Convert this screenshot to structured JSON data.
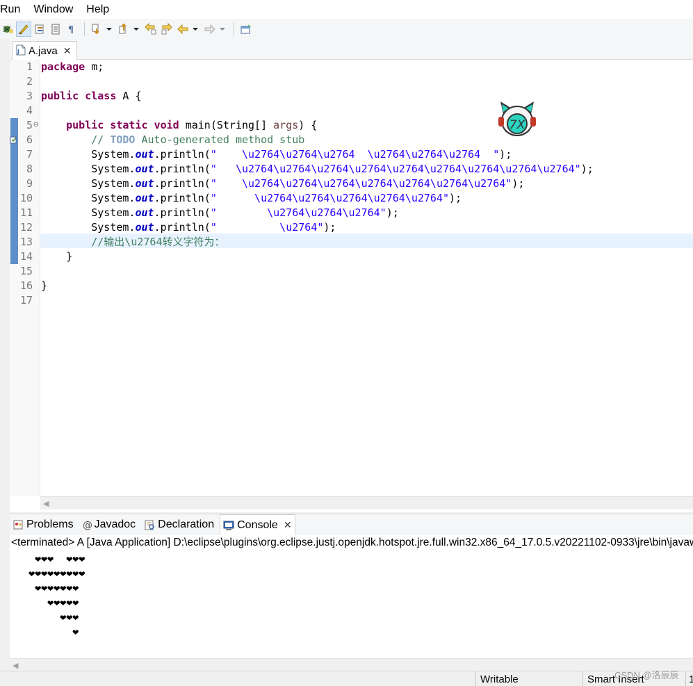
{
  "menubar": {
    "items": [
      "Run",
      "Window",
      "Help"
    ]
  },
  "editor": {
    "tab_label": "A.java",
    "line_numbers": [
      "1",
      "2",
      "3",
      "4",
      "5",
      "6",
      "7",
      "8",
      "9",
      "10",
      "11",
      "12",
      "13",
      "14",
      "15",
      "16",
      "17"
    ],
    "lines": [
      [
        {
          "t": "package",
          "c": "kw"
        },
        {
          "t": " m;"
        }
      ],
      [],
      [
        {
          "t": "public",
          "c": "kw"
        },
        {
          "t": " "
        },
        {
          "t": "class",
          "c": "kw"
        },
        {
          "t": " A {"
        }
      ],
      [],
      [
        {
          "t": "    "
        },
        {
          "t": "public",
          "c": "kw"
        },
        {
          "t": " "
        },
        {
          "t": "static",
          "c": "kw"
        },
        {
          "t": " "
        },
        {
          "t": "void",
          "c": "kw"
        },
        {
          "t": " main(String[] "
        },
        {
          "t": "args",
          "c": "param"
        },
        {
          "t": ") {"
        }
      ],
      [
        {
          "t": "        "
        },
        {
          "t": "// ",
          "c": "cmt"
        },
        {
          "t": "TODO",
          "c": "todo"
        },
        {
          "t": " Auto-generated method stub",
          "c": "cmt"
        }
      ],
      [
        {
          "t": "        System."
        },
        {
          "t": "out",
          "c": "field"
        },
        {
          "t": ".println("
        },
        {
          "t": "\"    \\u2764\\u2764\\u2764  \\u2764\\u2764\\u2764  \"",
          "c": "str"
        },
        {
          "t": ");"
        }
      ],
      [
        {
          "t": "        System."
        },
        {
          "t": "out",
          "c": "field"
        },
        {
          "t": ".println("
        },
        {
          "t": "\"   \\u2764\\u2764\\u2764\\u2764\\u2764\\u2764\\u2764\\u2764\\u2764\"",
          "c": "str"
        },
        {
          "t": ");"
        }
      ],
      [
        {
          "t": "        System."
        },
        {
          "t": "out",
          "c": "field"
        },
        {
          "t": ".println("
        },
        {
          "t": "\"    \\u2764\\u2764\\u2764\\u2764\\u2764\\u2764\\u2764\"",
          "c": "str"
        },
        {
          "t": ");"
        }
      ],
      [
        {
          "t": "        System."
        },
        {
          "t": "out",
          "c": "field"
        },
        {
          "t": ".println("
        },
        {
          "t": "\"      \\u2764\\u2764\\u2764\\u2764\\u2764\"",
          "c": "str"
        },
        {
          "t": ");"
        }
      ],
      [
        {
          "t": "        System."
        },
        {
          "t": "out",
          "c": "field"
        },
        {
          "t": ".println("
        },
        {
          "t": "\"        \\u2764\\u2764\\u2764\"",
          "c": "str"
        },
        {
          "t": ");"
        }
      ],
      [
        {
          "t": "        System."
        },
        {
          "t": "out",
          "c": "field"
        },
        {
          "t": ".println("
        },
        {
          "t": "\"          \\u2764\"",
          "c": "str"
        },
        {
          "t": ");"
        }
      ],
      [
        {
          "t": "        "
        },
        {
          "t": "//输出\\u2764转义字符为：",
          "c": "cmt"
        }
      ],
      [
        {
          "t": "    }"
        }
      ],
      [],
      [
        {
          "t": "}"
        }
      ],
      []
    ]
  },
  "panel": {
    "tabs": [
      {
        "label": "Problems",
        "icon": "problems-icon"
      },
      {
        "label": "Javadoc",
        "icon": "javadoc-icon"
      },
      {
        "label": "Declaration",
        "icon": "declaration-icon"
      },
      {
        "label": "Console",
        "icon": "console-icon",
        "selected": true
      }
    ],
    "console_header": "<terminated> A [Java Application] D:\\eclipse\\plugins\\org.eclipse.justj.openjdk.hotspot.jre.full.win32.x86_64_17.0.5.v20221102-0933\\jre\\bin\\javaw.exe",
    "console_lines": [
      "    ❤❤❤  ❤❤❤  ",
      "   ❤❤❤❤❤❤❤❤❤",
      "    ❤❤❤❤❤❤❤",
      "      ❤❤❤❤❤",
      "        ❤❤❤",
      "          ❤"
    ]
  },
  "statusbar": {
    "writable": "Writable",
    "insert_mode": "Smart Insert",
    "position": "1"
  },
  "watermark": "CSDN @洛辰辰",
  "colors": {
    "keyword": "#7f0055",
    "string": "#2a00ff",
    "field": "#0000c0",
    "comment": "#3f7f5f",
    "todo": "#7f9fbf",
    "current_line": "#e8f2fe",
    "change_marker": "#5e8fc8",
    "mascot_teal": "#2bd4c0"
  }
}
